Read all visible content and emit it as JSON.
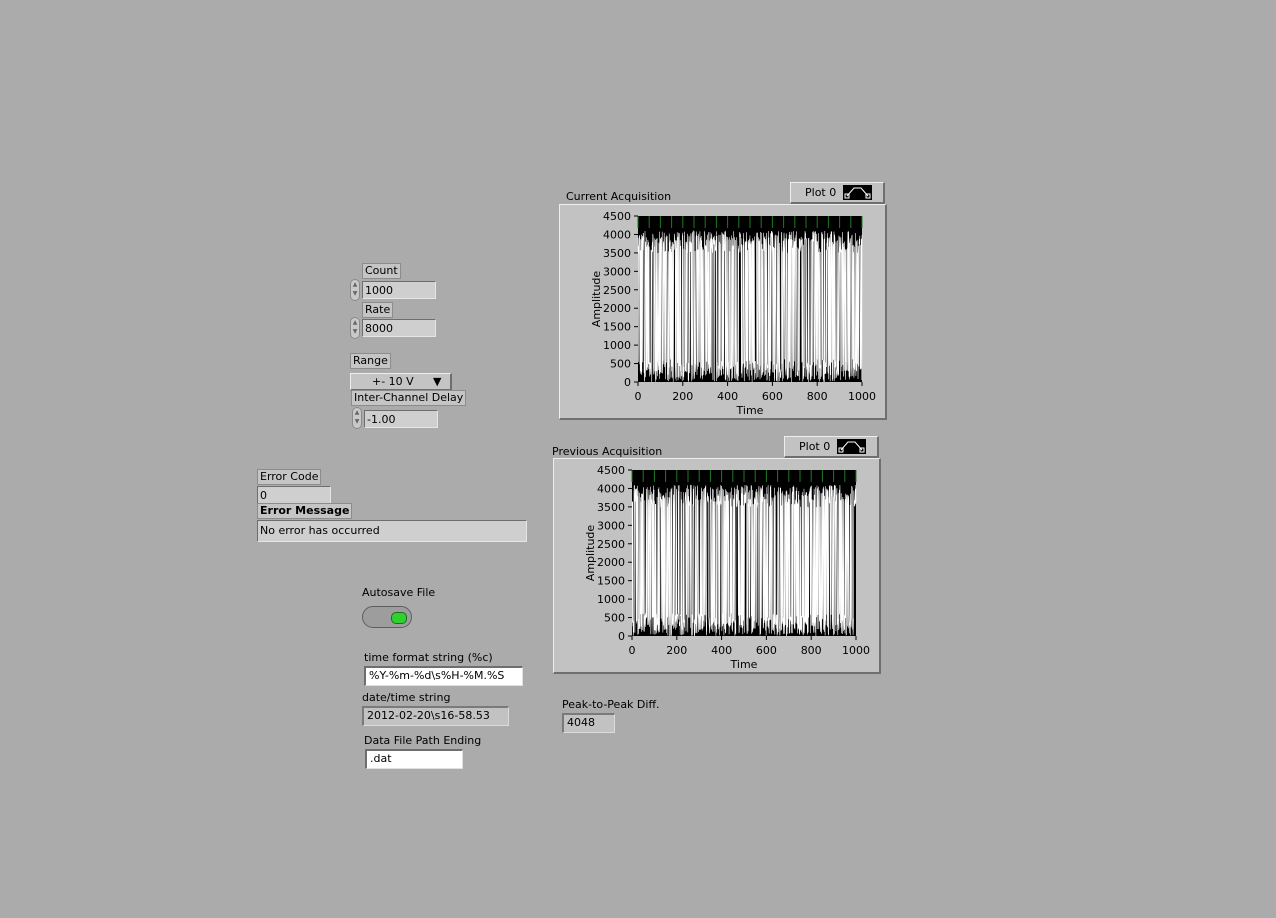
{
  "controls": {
    "count": {
      "label": "Count",
      "value": "1000"
    },
    "rate": {
      "label": "Rate",
      "value": "8000"
    },
    "range": {
      "label": "Range",
      "value": "+- 10 V"
    },
    "inter_channel_delay": {
      "label": "Inter-Channel Delay",
      "value": "-1.00"
    }
  },
  "error": {
    "code_label": "Error Code",
    "code_value": "0",
    "message_label": "Error Message",
    "message_value": "No error has occurred"
  },
  "autosave": {
    "label": "Autosave File",
    "led_state": "on",
    "led_color": "#2fd12f"
  },
  "time_format": {
    "label": "time format string (%c)",
    "value": "%Y-%m-%d\\s%H-%M.%S"
  },
  "datetime": {
    "label": "date/time string",
    "value": "2012-02-20\\s16-58.53"
  },
  "data_file": {
    "label": "Data File Path Ending",
    "value": ".dat"
  },
  "peak": {
    "label": "Peak-to-Peak Diff.",
    "value": "4048"
  },
  "graphs": [
    {
      "title": "Current Acquisition",
      "legend": "Plot 0",
      "xlabel": "Time",
      "ylabel": "Amplitude",
      "y_ticks": [
        "4500",
        "4000",
        "3500",
        "3000",
        "2500",
        "2000",
        "1500",
        "1000",
        "500",
        "0"
      ],
      "x_ticks": [
        "0",
        "200",
        "400",
        "600",
        "800",
        "1000"
      ]
    },
    {
      "title": "Previous Acquisition",
      "legend": "Plot 0",
      "xlabel": "Time",
      "ylabel": "Amplitude",
      "y_ticks": [
        "4500",
        "4000",
        "3500",
        "3000",
        "2500",
        "2000",
        "1500",
        "1000",
        "500",
        "0"
      ],
      "x_ticks": [
        "0",
        "200",
        "400",
        "600",
        "800",
        "1000"
      ]
    }
  ],
  "chart_data": [
    {
      "type": "line",
      "title": "Current Acquisition",
      "xlabel": "Time",
      "ylabel": "Amplitude",
      "xlim": [
        0,
        1000
      ],
      "ylim": [
        0,
        4500
      ],
      "series": [
        {
          "name": "Plot 0",
          "min": 0,
          "max": 4096,
          "count": 1000
        }
      ],
      "plot_bg": "#000000",
      "trace_color": "#ffffff",
      "grid_color": "#1f7a1f"
    },
    {
      "type": "line",
      "title": "Previous Acquisition",
      "xlabel": "Time",
      "ylabel": "Amplitude",
      "xlim": [
        0,
        1000
      ],
      "ylim": [
        0,
        4500
      ],
      "series": [
        {
          "name": "Plot 0",
          "min": 0,
          "max": 4096,
          "count": 1000
        }
      ],
      "plot_bg": "#000000",
      "trace_color": "#ffffff",
      "grid_color": "#1f7a1f"
    }
  ]
}
